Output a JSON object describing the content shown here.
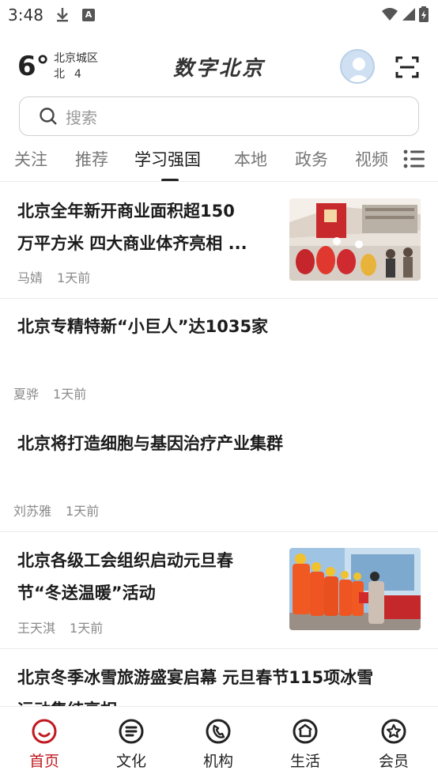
{
  "status_bar": {
    "time": "3:48",
    "icons": [
      "download-icon",
      "a-badge-icon",
      "wifi-icon",
      "signal-icon",
      "battery-icon"
    ]
  },
  "header": {
    "temperature": "6°",
    "location": "北京城区",
    "wind_direction": "北",
    "wind_level": "4",
    "brand": "数字北京"
  },
  "search": {
    "placeholder": "搜索"
  },
  "tabs": [
    {
      "label": "关注"
    },
    {
      "label": "推荐"
    },
    {
      "label": "学习强国",
      "active": true
    },
    {
      "label": "本地"
    },
    {
      "label": "政务"
    },
    {
      "label": "视频"
    }
  ],
  "feed": [
    {
      "title_line1": "北京全年新开商业面积超150",
      "title_line2": "万平方米 四大商业体齐亮相 ...",
      "author": "马婧",
      "time": "1天前",
      "has_image": true
    },
    {
      "title_line1": "北京专精特新“小巨人”达1035家",
      "author": "夏骅",
      "time": "1天前"
    },
    {
      "title_line1": "北京将打造细胞与基因治疗产业集群",
      "author": "刘苏雅",
      "time": "1天前"
    },
    {
      "title_line1": "北京各级工会组织启动元旦春",
      "title_line2": "节“冬送温暖”活动",
      "author": "王天淇",
      "time": "1天前",
      "has_image": true
    },
    {
      "title_line1": "北京冬季冰雪旅游盛宴启幕 元旦春节115项冰雪",
      "title_line2": "运动集结亮相"
    }
  ],
  "bottom_nav": [
    {
      "label": "首页",
      "icon": "home-icon",
      "active": true
    },
    {
      "label": "文化",
      "icon": "culture-icon"
    },
    {
      "label": "机构",
      "icon": "institution-icon"
    },
    {
      "label": "生活",
      "icon": "life-icon"
    },
    {
      "label": "会员",
      "icon": "member-icon"
    }
  ],
  "colors": {
    "accent": "#c0191f",
    "text": "#1c1c1c",
    "muted": "#8a8a8a"
  }
}
